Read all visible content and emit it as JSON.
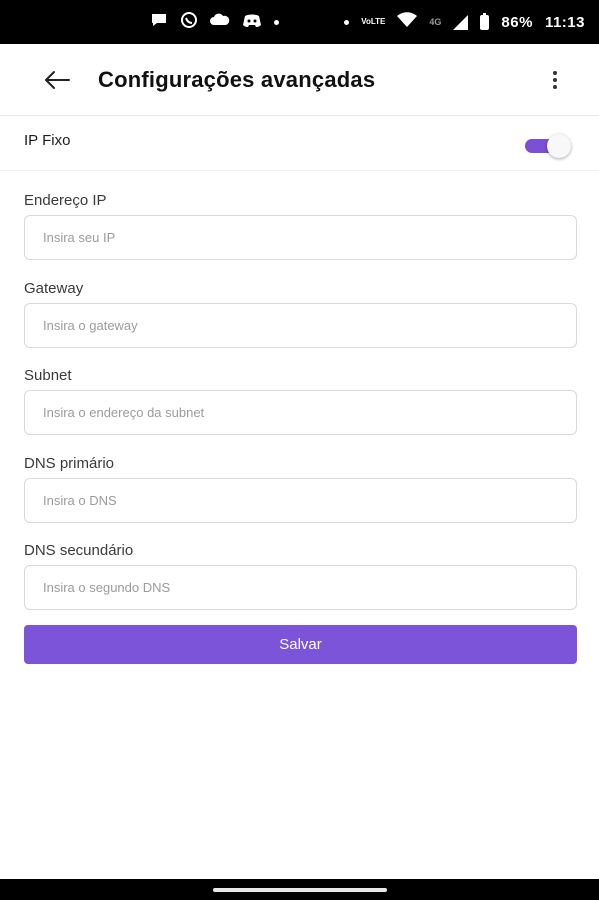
{
  "status_bar": {
    "battery": "86%",
    "time": "11:13",
    "network": "4G",
    "volte": "VoLTE",
    "icons": [
      "chat-icon",
      "whatsapp-icon",
      "cloud-game-icon",
      "discord-icon",
      "notification-dot",
      "wifi-icon",
      "signal-icon",
      "battery-icon"
    ]
  },
  "app_bar": {
    "title": "Configurações avançadas",
    "back_icon": "arrow-left-icon",
    "menu_icon": "more-vertical-icon"
  },
  "toggle": {
    "label": "IP Fixo",
    "checked": true,
    "accent": "#7b4fd6"
  },
  "form": {
    "fields": [
      {
        "label": "Endereço IP",
        "placeholder": "Insira seu IP",
        "value": ""
      },
      {
        "label": "Gateway",
        "placeholder": "Insira o gateway",
        "value": ""
      },
      {
        "label": "Subnet",
        "placeholder": "Insira o endereço da subnet",
        "value": ""
      },
      {
        "label": "DNS primário",
        "placeholder": "Insira o DNS",
        "value": ""
      },
      {
        "label": "DNS secundário",
        "placeholder": "Insira o segundo DNS",
        "value": ""
      }
    ],
    "submit_label": "Salvar",
    "button_color": "#7b54d9"
  }
}
